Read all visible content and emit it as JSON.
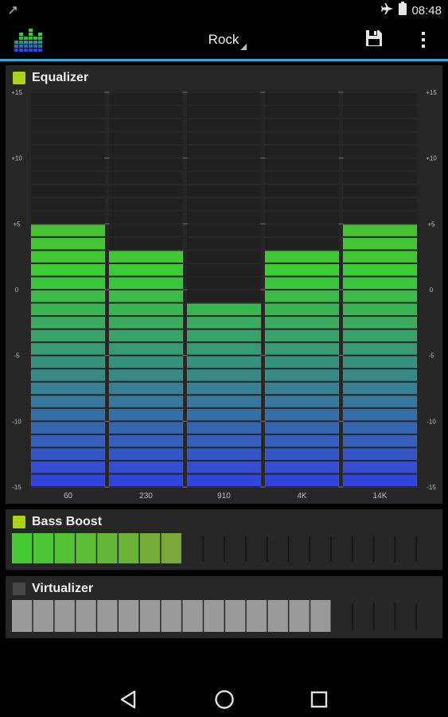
{
  "status_bar": {
    "time": "08:48",
    "left_icon": "notification-icon",
    "airplane_icon": "airplane-icon",
    "battery_icon": "battery-icon"
  },
  "action_bar": {
    "app_icon": "equalizer-app-icon",
    "preset": "Rock",
    "save_icon": "save-icon",
    "menu_icon": "overflow-menu-icon",
    "accent_color": "#3aa5d8"
  },
  "equalizer": {
    "title": "Equalizer",
    "enabled": true,
    "scale_labels": [
      "+15",
      "+10",
      "+5",
      "0",
      "-5",
      "-10",
      "-15"
    ],
    "bands": [
      {
        "freq": "60",
        "level_db": 5
      },
      {
        "freq": "230",
        "level_db": 3
      },
      {
        "freq": "910",
        "level_db": -1
      },
      {
        "freq": "4K",
        "level_db": 3
      },
      {
        "freq": "14K",
        "level_db": 5
      }
    ],
    "range_db": [
      -15,
      15
    ]
  },
  "bass_boost": {
    "title": "Bass Boost",
    "enabled": true,
    "level_segments": 8,
    "total_segments": 19,
    "color": "#44cc33"
  },
  "virtualizer": {
    "title": "Virtualizer",
    "enabled": false,
    "level_segments": 15,
    "total_segments": 19,
    "color": "#9a9a9a"
  },
  "nav_bar": {
    "back_icon": "back-icon",
    "home_icon": "home-icon",
    "recents_icon": "recents-icon"
  },
  "colors": {
    "checkbox_on": "#a8d317",
    "checkbox_off": "#464646",
    "eq_top": "#6a9a30",
    "eq_mid": "#3ccc33",
    "eq_bottom": "#3344dd"
  }
}
